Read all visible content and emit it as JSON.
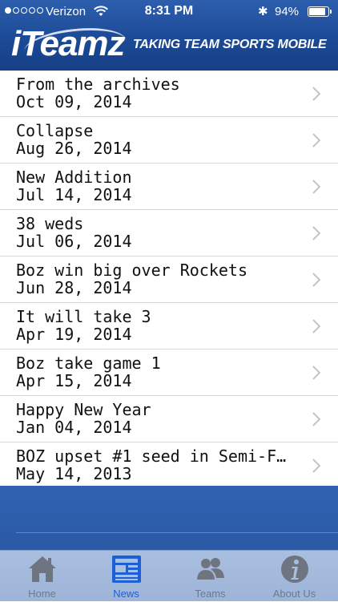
{
  "status_bar": {
    "carrier": "Verizon",
    "time": "8:31 PM",
    "battery": "94%"
  },
  "header": {
    "logo": "iTeamz",
    "tagline": "TAKING TEAM SPORTS MOBILE"
  },
  "news": [
    {
      "title": "From the archives",
      "date": "Oct 09, 2014"
    },
    {
      "title": "Collapse",
      "date": "Aug 26, 2014"
    },
    {
      "title": "New Addition",
      "date": "Jul 14, 2014"
    },
    {
      "title": "38 weds",
      "date": "Jul 06, 2014"
    },
    {
      "title": "Boz win big over Rockets",
      "date": "Jun 28, 2014"
    },
    {
      "title": "It will take 3",
      "date": "Apr 19, 2014"
    },
    {
      "title": "Boz take game 1",
      "date": "Apr 15, 2014"
    },
    {
      "title": "Happy New Year",
      "date": "Jan 04, 2014"
    },
    {
      "title": "BOZ upset #1 seed in Semi-F…",
      "date": "May 14, 2013"
    }
  ],
  "tabs": [
    {
      "label": "Home",
      "icon": "home-icon"
    },
    {
      "label": "News",
      "icon": "news-icon"
    },
    {
      "label": "Teams",
      "icon": "teams-icon"
    },
    {
      "label": "About Us",
      "icon": "info-icon"
    }
  ],
  "active_tab": "News"
}
